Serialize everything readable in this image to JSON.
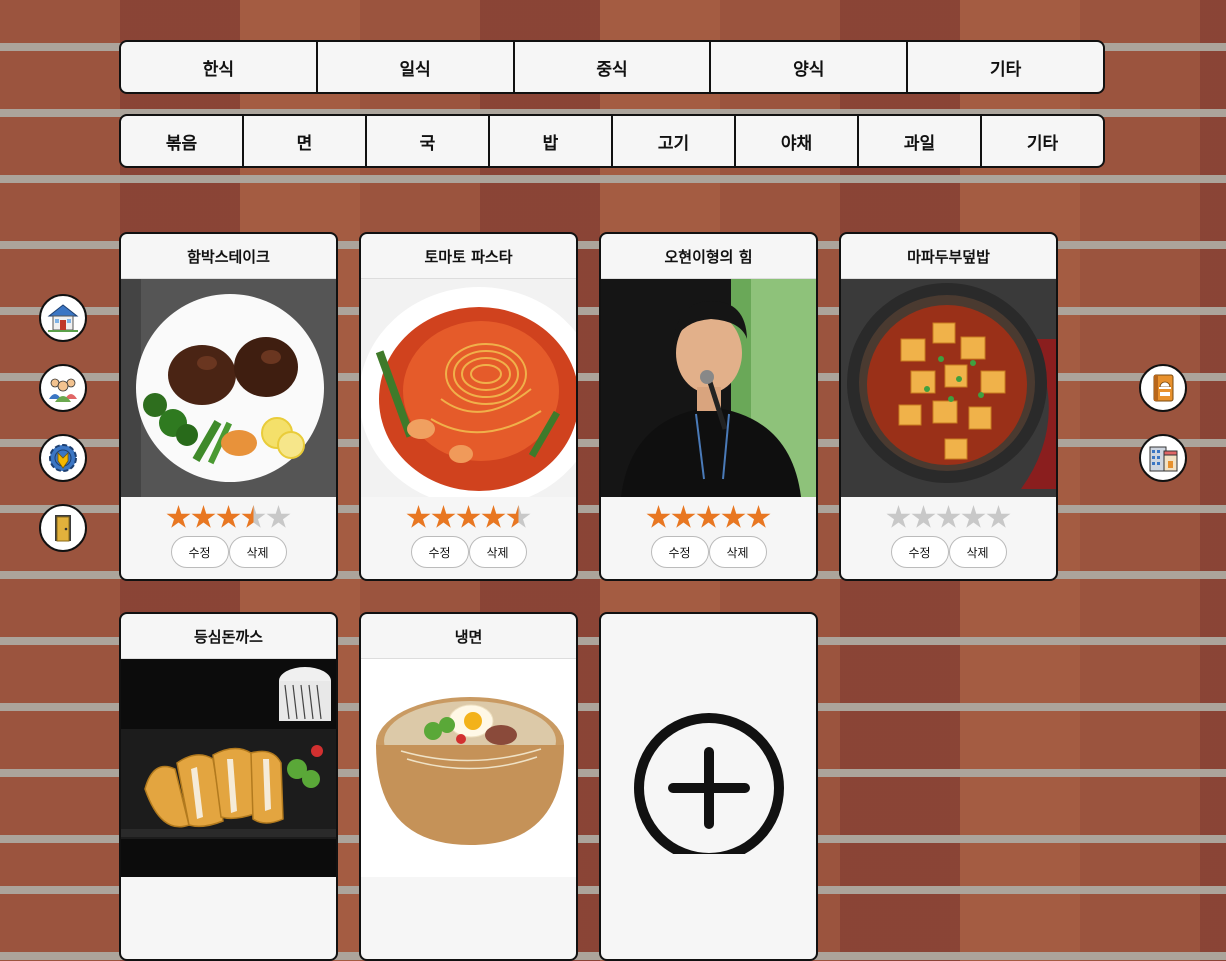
{
  "cuisine_tabs": [
    "한식",
    "일식",
    "중식",
    "양식",
    "기타"
  ],
  "type_tabs": [
    "볶음",
    "면",
    "국",
    "밥",
    "고기",
    "야채",
    "과일",
    "기타"
  ],
  "left_nav": [
    "home-icon",
    "community-icon",
    "settings-icon",
    "exit-door-icon"
  ],
  "right_nav": [
    "recipe-book-icon",
    "restaurant-icon"
  ],
  "recipes": [
    {
      "title": "함박스테이크",
      "rating": 3.5
    },
    {
      "title": "토마토 파스타",
      "rating": 4.5
    },
    {
      "title": "오현이형의 힘",
      "rating": 5
    },
    {
      "title": "마파두부덮밥",
      "rating": 0
    },
    {
      "title": "등심돈까스"
    },
    {
      "title": "냉면"
    }
  ],
  "card_actions": {
    "edit": "수정",
    "delete": "삭제"
  },
  "add_card": {
    "icon": "plus-circle-icon"
  },
  "colors": {
    "star_filled": "#e87722",
    "star_empty": "#c8c8c8",
    "border": "#111111",
    "card_bg": "#f6f6f6"
  }
}
